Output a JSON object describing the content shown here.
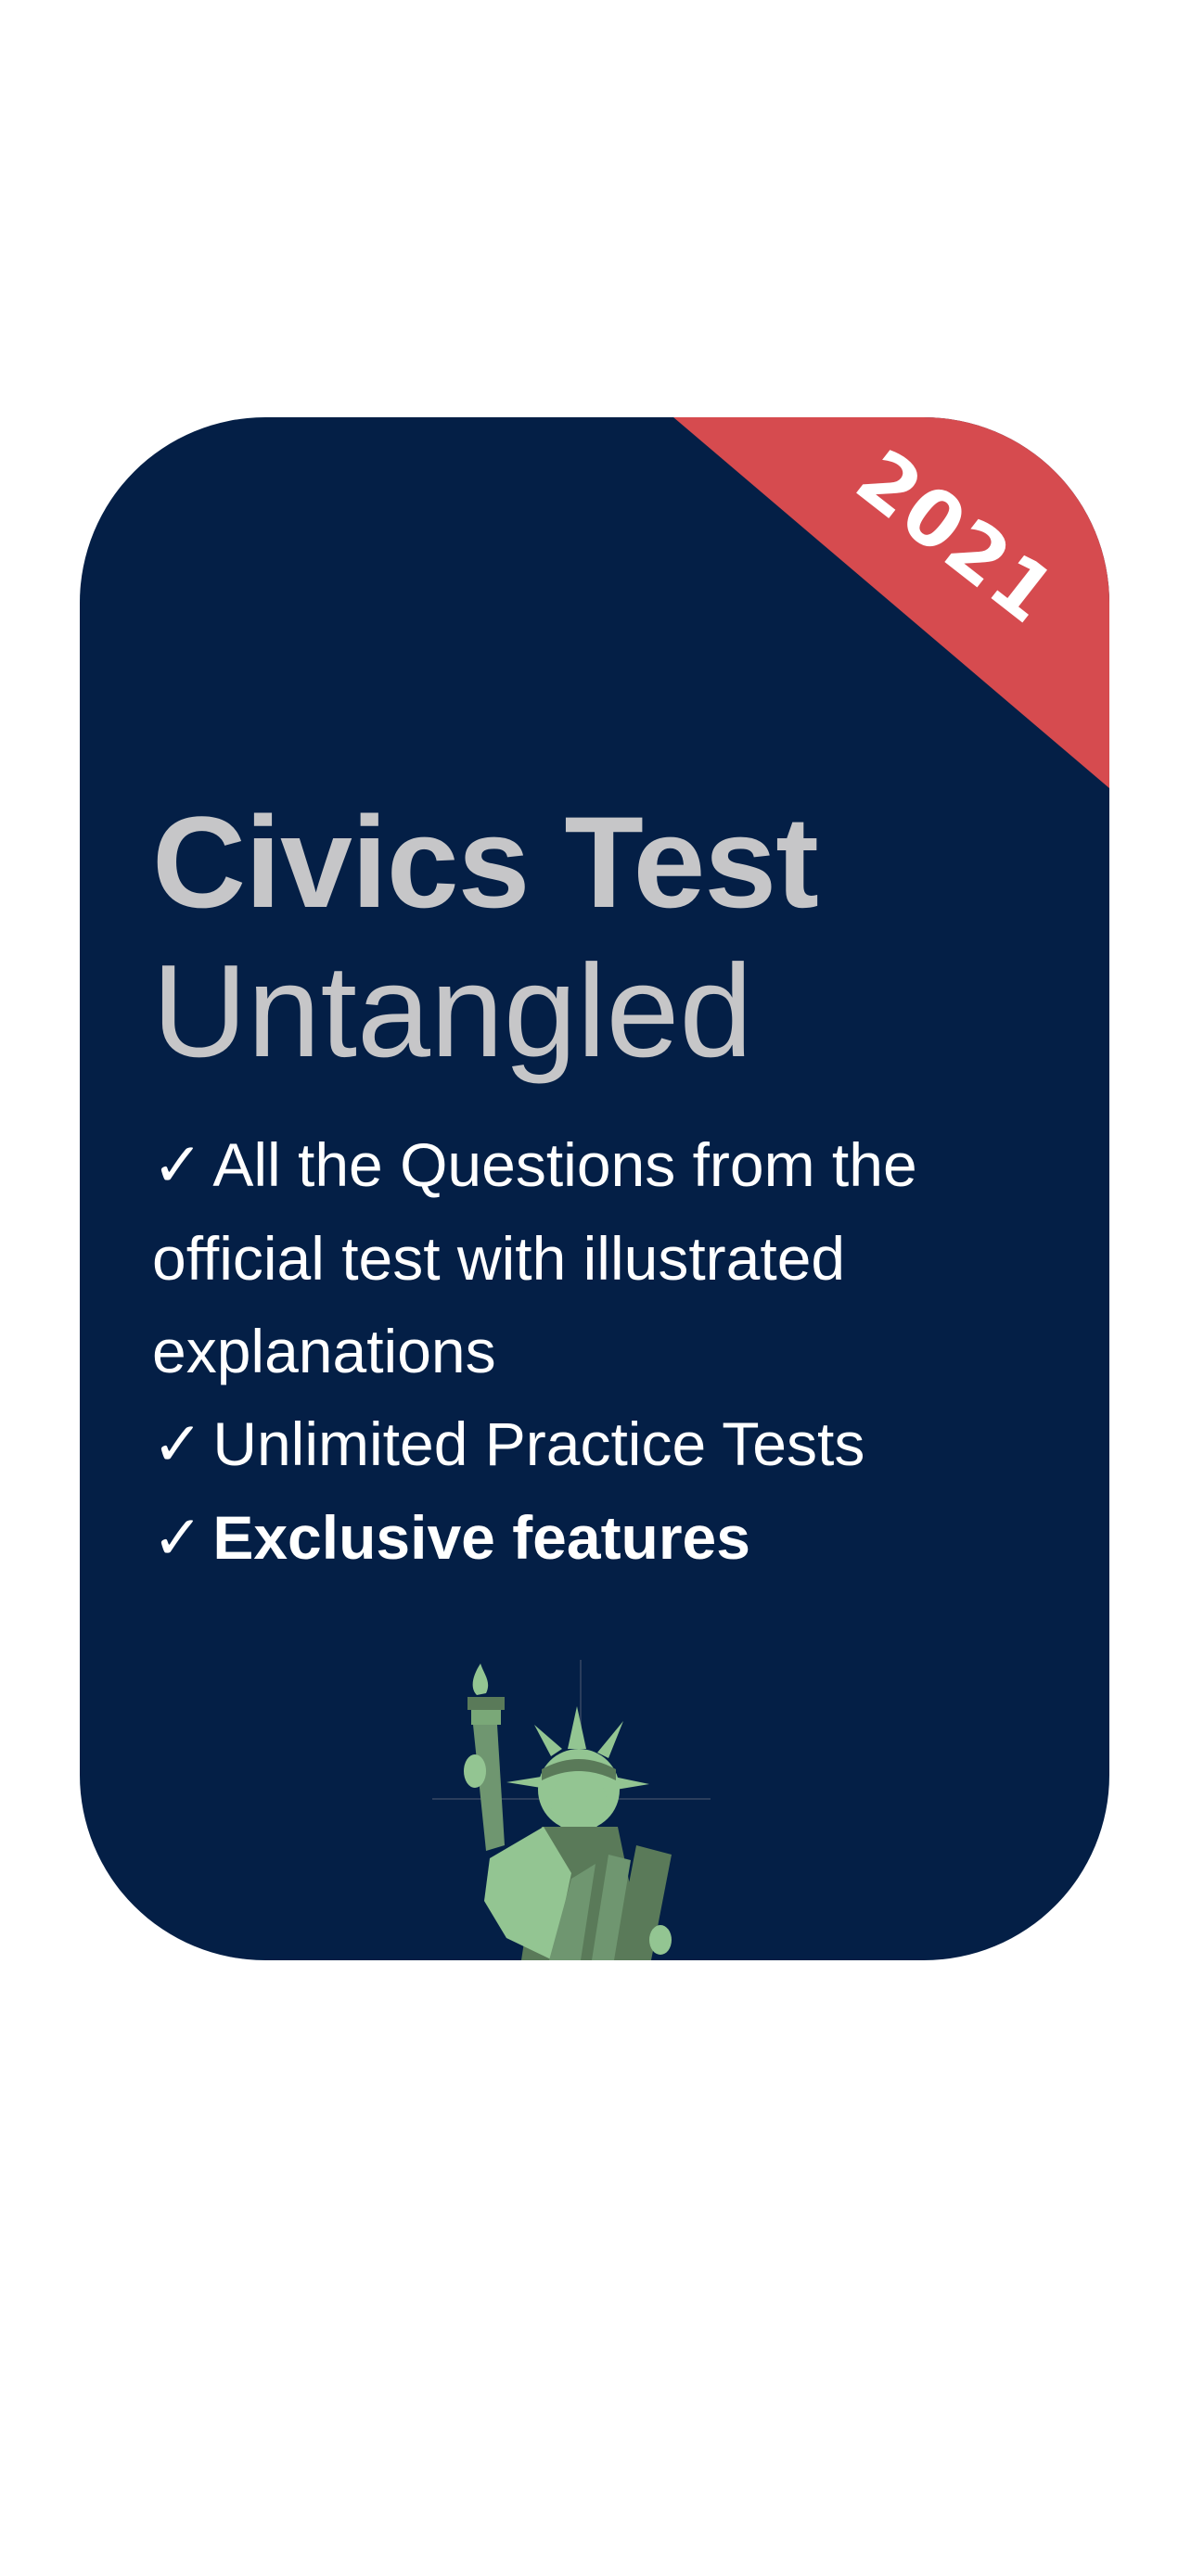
{
  "card": {
    "year_badge": "2021",
    "title_bold": "Civics Test",
    "title_light": "Untangled",
    "check_mark": "✓",
    "features": [
      {
        "text": "All the Questions from the official test with illustrated explanations"
      },
      {
        "text": "Unlimited Practice Tests"
      },
      {
        "text": "Exclusive features"
      }
    ],
    "illustration": "statue-of-liberty-icon"
  },
  "colors": {
    "page_background": "#ffffff",
    "card_background": "#041f46",
    "corner_ribbon": "#d64b4f",
    "title_text": "#c6c6c8",
    "feature_text": "#ffffff",
    "statue_light": "#93c592",
    "statue_dark": "#5a7a59"
  }
}
